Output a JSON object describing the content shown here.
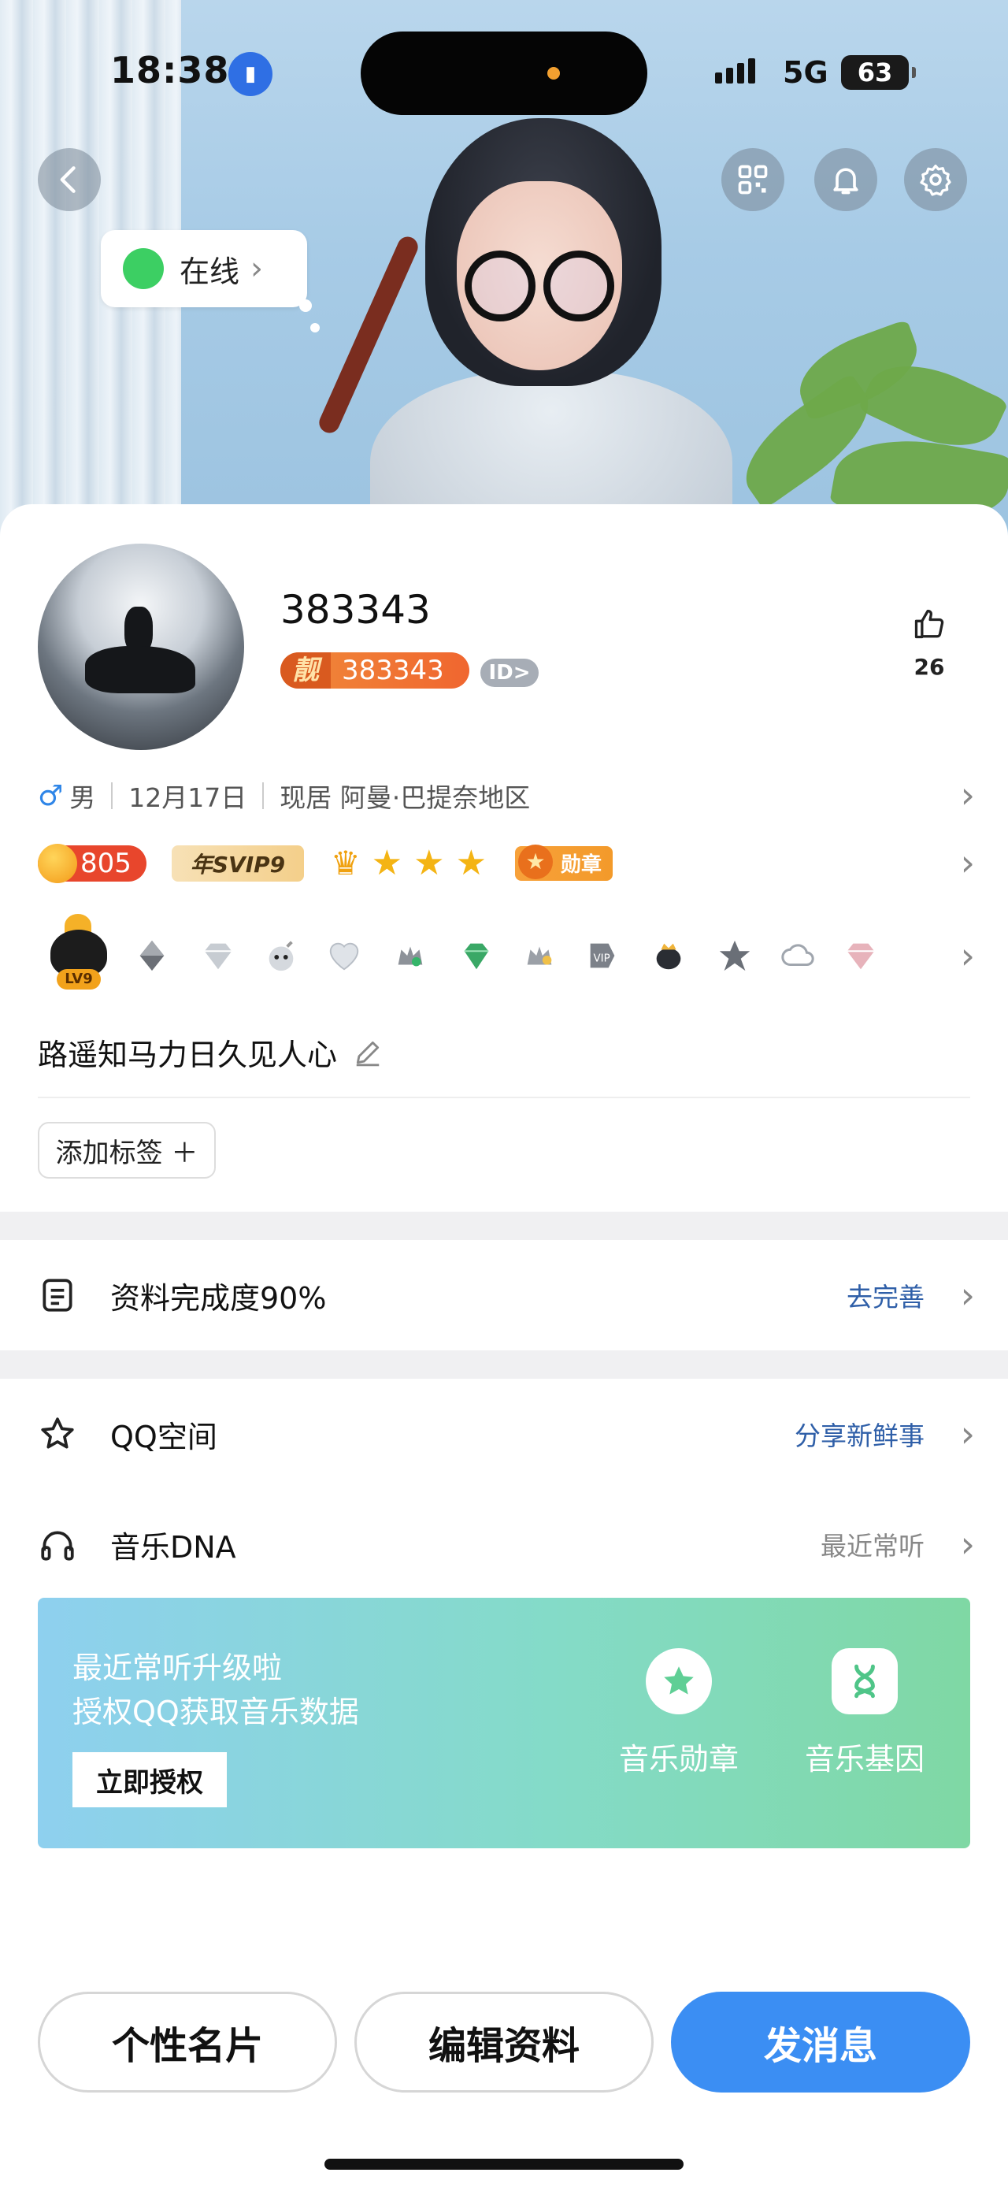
{
  "status_bar": {
    "time": "18:38",
    "network": "5G",
    "battery": "63"
  },
  "hero": {
    "online_status": "在线"
  },
  "profile": {
    "nickname": "383343",
    "liang_char": "靓",
    "liang_number": "383343",
    "id_badge": "ID>",
    "likes": "26"
  },
  "info": {
    "gender_symbol": "♂",
    "gender": "男",
    "birthday": "12月17日",
    "location": "现居 阿曼·巴提奈地区"
  },
  "badges": {
    "coin": "805",
    "svip": "年SVIP9",
    "medal": "勋章",
    "level": "LV9"
  },
  "signature": "路遥知马力日久见人心",
  "add_tag": "添加标签 ＋",
  "completeness": {
    "label": "资料完成度90%",
    "action": "去完善"
  },
  "qzone": {
    "label": "QQ空间",
    "action": "分享新鲜事"
  },
  "music": {
    "label": "音乐DNA",
    "action": "最近常听",
    "line1": "最近常听升级啦",
    "line2": "授权QQ获取音乐数据",
    "auth_button": "立即授权",
    "feature1": "音乐勋章",
    "feature2": "音乐基因"
  },
  "bottom": {
    "card": "个性名片",
    "edit": "编辑资料",
    "message": "发消息"
  },
  "colors": {
    "primary": "#3b8ef3",
    "online": "#3ccf63",
    "link": "#2f5fa8"
  }
}
